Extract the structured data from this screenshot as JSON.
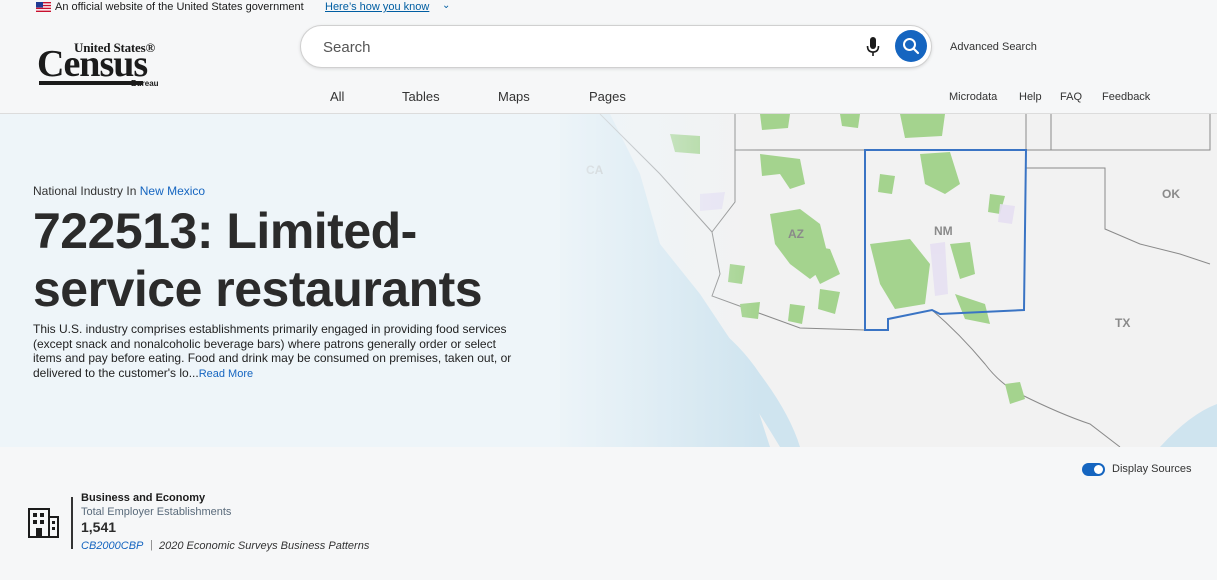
{
  "gov_banner": {
    "text": "An official website of the United States government",
    "link": "Here’s how you know",
    "chevron": "⌄"
  },
  "logo": {
    "line1": "United States®",
    "line2": "Census",
    "line3": "Bureau"
  },
  "search": {
    "placeholder": "Search",
    "advanced": "Advanced Search",
    "mic_icon": "microphone-icon",
    "button_icon": "search-icon"
  },
  "tabs": [
    "All",
    "Tables",
    "Maps",
    "Pages"
  ],
  "utility_links": [
    "Microdata",
    "Help",
    "FAQ",
    "Feedback"
  ],
  "hero": {
    "eyebrow": "National Industry In",
    "state": "New Mexico",
    "title": "722513: Limited-service restaurants",
    "description": "This U.S. industry comprises establishments primarily engaged in providing food services (except snack and nonalcoholic beverage bars) where patrons generally order or select items and pay before eating. Food and drink may be consumed on premises, taken out, or delivered to the customer's lo...",
    "read_more": "Read More"
  },
  "map_labels": {
    "ca": "CA",
    "az": "AZ",
    "nm": "NM",
    "ok": "OK",
    "tx": "TX"
  },
  "sources_toggle": {
    "label": "Display Sources",
    "on": true
  },
  "stat": {
    "category": "Business and Economy",
    "metric": "Total Employer Establishments",
    "value": "1,541",
    "source_code": "CB2000CBP",
    "separator": "|",
    "source_name": "2020 Economic Surveys Business Patterns"
  },
  "colors": {
    "accent": "#1565c0",
    "land_green": "#9fcf8a",
    "water": "#cde3ee",
    "highlight_border": "#3a74c4"
  }
}
